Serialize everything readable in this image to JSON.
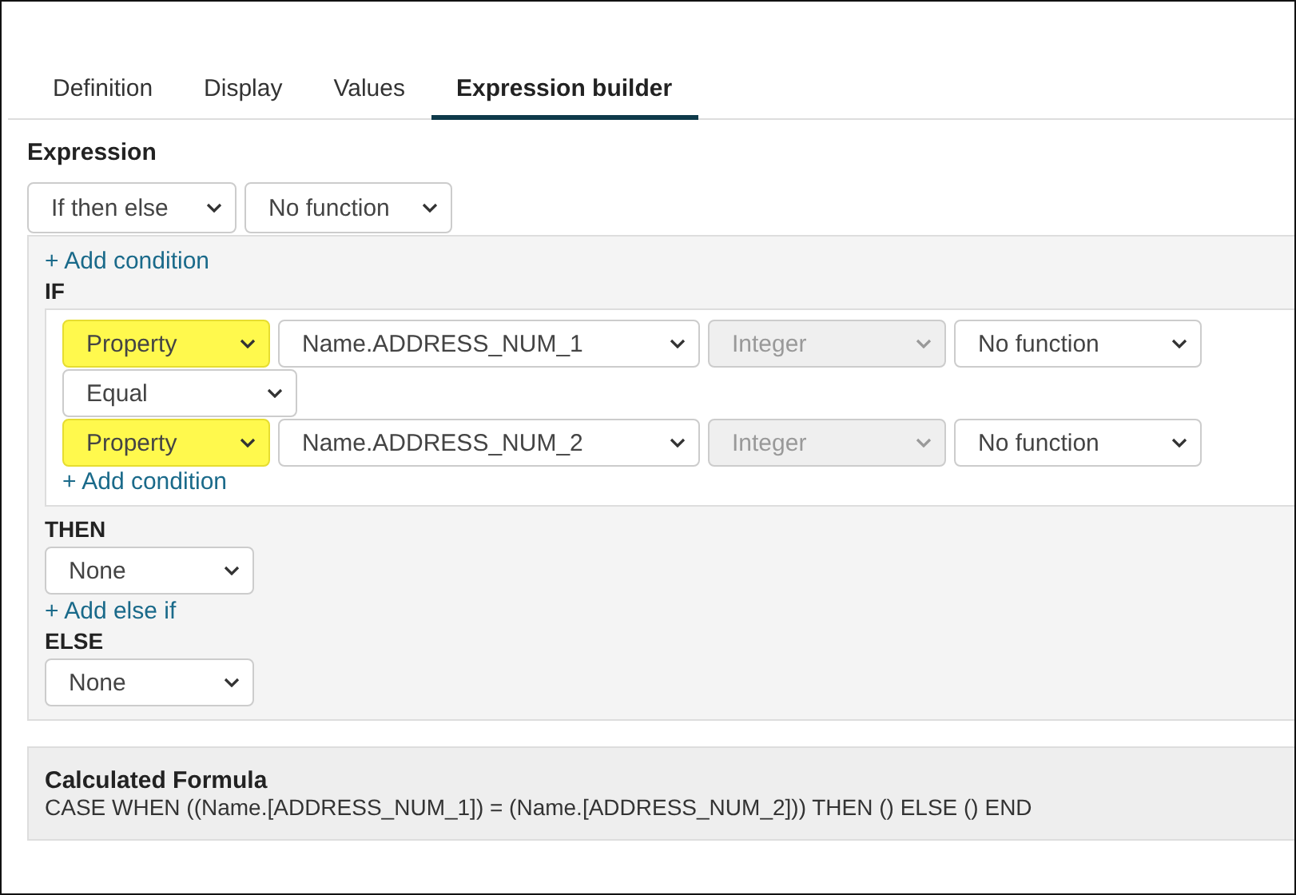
{
  "tabs": [
    {
      "label": "Definition",
      "selected": false
    },
    {
      "label": "Display",
      "selected": false
    },
    {
      "label": "Values",
      "selected": false
    },
    {
      "label": "Expression builder",
      "selected": true
    }
  ],
  "expression": {
    "heading": "Expression",
    "selects": [
      {
        "value": "If then else",
        "highlighted": false,
        "disabled": false
      },
      {
        "value": "No function",
        "highlighted": false,
        "disabled": false
      }
    ],
    "add_condition": "+ Add condition",
    "if_label": "IF",
    "if_rows": [
      {
        "selects": [
          {
            "value": "Property",
            "highlighted": true,
            "disabled": false
          },
          {
            "value": "Name.ADDRESS_NUM_1",
            "highlighted": false,
            "disabled": false
          },
          {
            "value": "Integer",
            "highlighted": false,
            "disabled": true
          },
          {
            "value": "No function",
            "highlighted": false,
            "disabled": false
          }
        ]
      },
      {
        "selects": [
          {
            "value": "Equal",
            "highlighted": false,
            "disabled": false
          }
        ]
      },
      {
        "selects": [
          {
            "value": "Property",
            "highlighted": true,
            "disabled": false
          },
          {
            "value": "Name.ADDRESS_NUM_2",
            "highlighted": false,
            "disabled": false
          },
          {
            "value": "Integer",
            "highlighted": false,
            "disabled": true
          },
          {
            "value": "No function",
            "highlighted": false,
            "disabled": false
          }
        ]
      }
    ],
    "inner_add_condition": "+ Add condition",
    "then_label": "THEN",
    "then_select": {
      "value": "None",
      "highlighted": false,
      "disabled": false
    },
    "add_else_if": "+ Add else if",
    "else_label": "ELSE",
    "else_select": {
      "value": "None",
      "highlighted": false,
      "disabled": false
    }
  },
  "formula": {
    "title": "Calculated Formula",
    "text": "CASE WHEN ((Name.[ADDRESS_NUM_1]) = (Name.[ADDRESS_NUM_2])) THEN () ELSE () END"
  }
}
